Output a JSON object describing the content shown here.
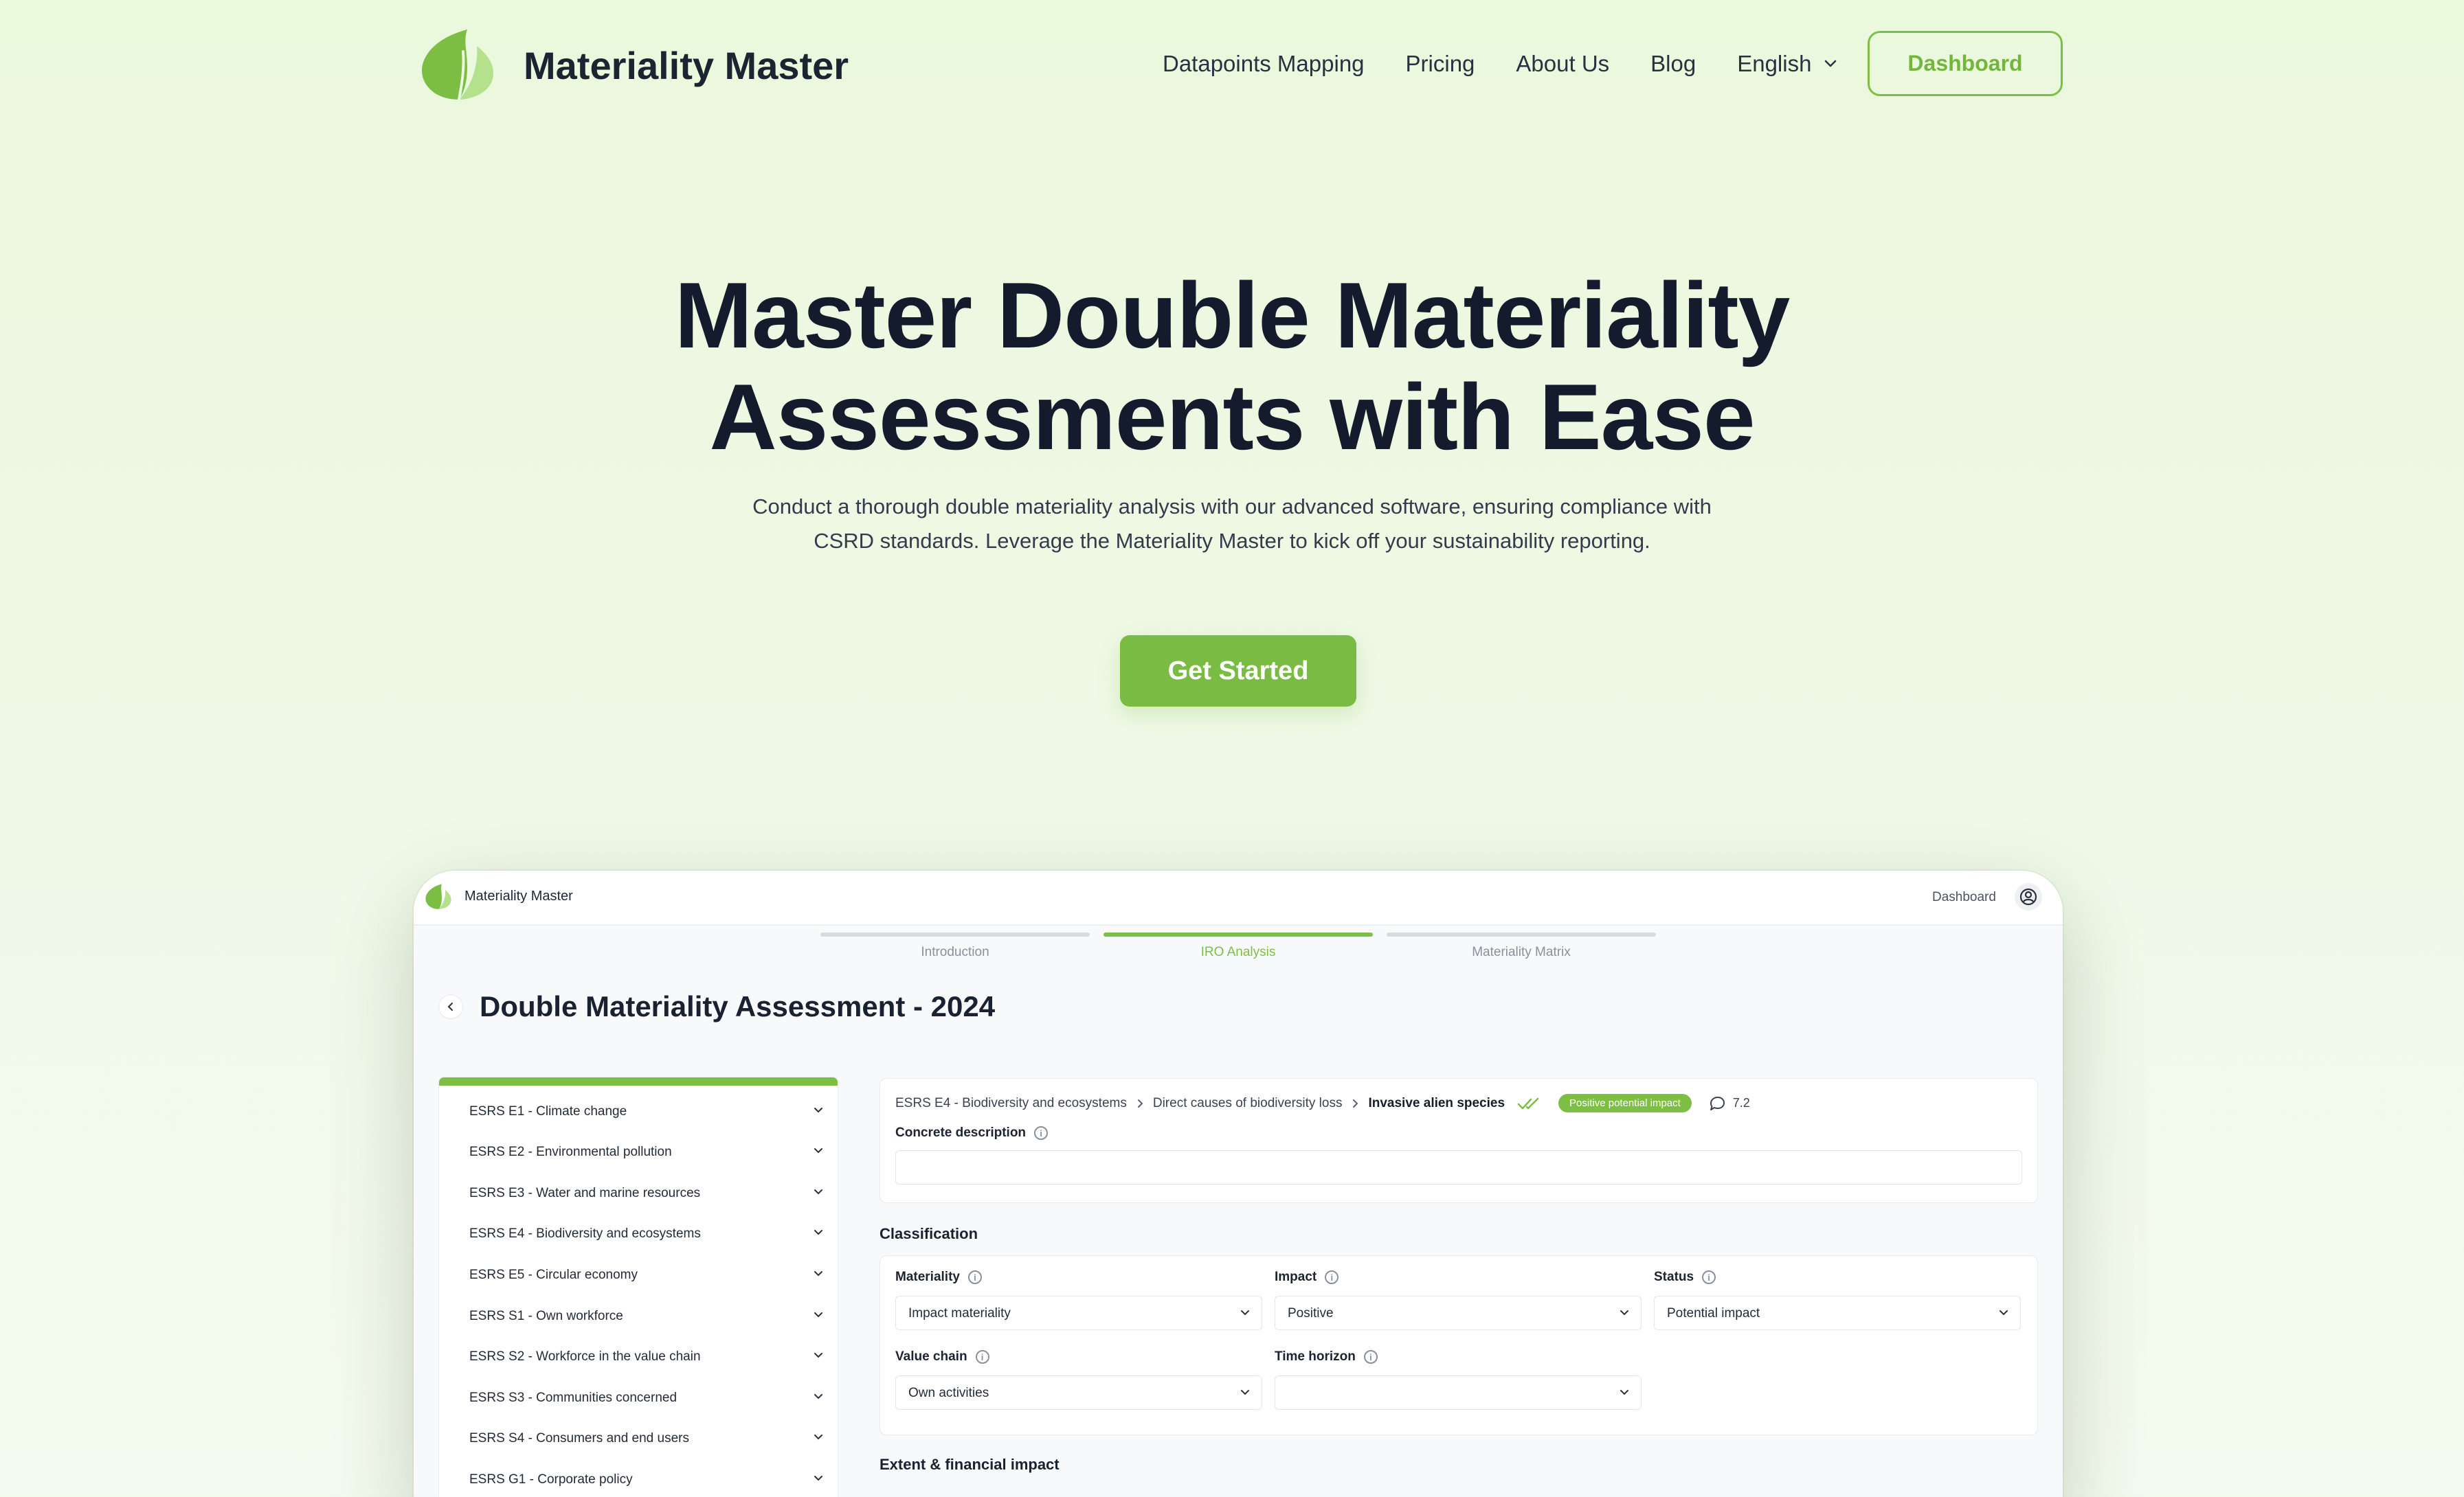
{
  "colors": {
    "accent": "#7dbf45",
    "heading": "#141b2d",
    "background": "#eef8e4"
  },
  "nav": {
    "brand": "Materiality Master",
    "links": [
      "Datapoints Mapping",
      "Pricing",
      "About Us",
      "Blog"
    ],
    "language": "English",
    "dashboard_label": "Dashboard"
  },
  "hero": {
    "title_line1": "Master Double Materiality",
    "title_line2": "Assessments with Ease",
    "subtitle_line1": "Conduct a thorough double materiality analysis with our advanced software, ensuring compliance with",
    "subtitle_line2": "CSRD standards. Leverage the Materiality Master to kick off your sustainability reporting.",
    "cta_label": "Get Started"
  },
  "app": {
    "brand": "Materiality Master",
    "dashboard_label": "Dashboard",
    "steps": [
      {
        "label": "Introduction",
        "active": false
      },
      {
        "label": "IRO Analysis",
        "active": true
      },
      {
        "label": "Materiality Matrix",
        "active": false
      }
    ],
    "page_title": "Double Materiality Assessment - 2024",
    "sidebar": [
      "ESRS E1 - Climate change",
      "ESRS E2 - Environmental pollution",
      "ESRS E3 - Water and marine resources",
      "ESRS E4 - Biodiversity and ecosystems",
      "ESRS E5 - Circular economy",
      "ESRS S1 - Own workforce",
      "ESRS S2 - Workforce in the value chain",
      "ESRS S3 - Communities concerned",
      "ESRS S4 - Consumers and end users",
      "ESRS G1 - Corporate policy"
    ],
    "breadcrumb": {
      "level1": "ESRS E4 - Biodiversity and ecosystems",
      "level2": "Direct causes of biodiversity loss",
      "level3": "Invasive alien species",
      "badge": "Positive potential impact",
      "comment_count": "7.2"
    },
    "concrete_description_label": "Concrete description",
    "concrete_description_value": "",
    "classification": {
      "title": "Classification",
      "materiality_label": "Materiality",
      "materiality_value": "Impact materiality",
      "impact_label": "Impact",
      "impact_value": "Positive",
      "status_label": "Status",
      "status_value": "Potential impact",
      "value_chain_label": "Value chain",
      "value_chain_value": "Own activities",
      "time_horizon_label": "Time horizon",
      "time_horizon_value": ""
    },
    "extent_title": "Extent & financial impact"
  }
}
